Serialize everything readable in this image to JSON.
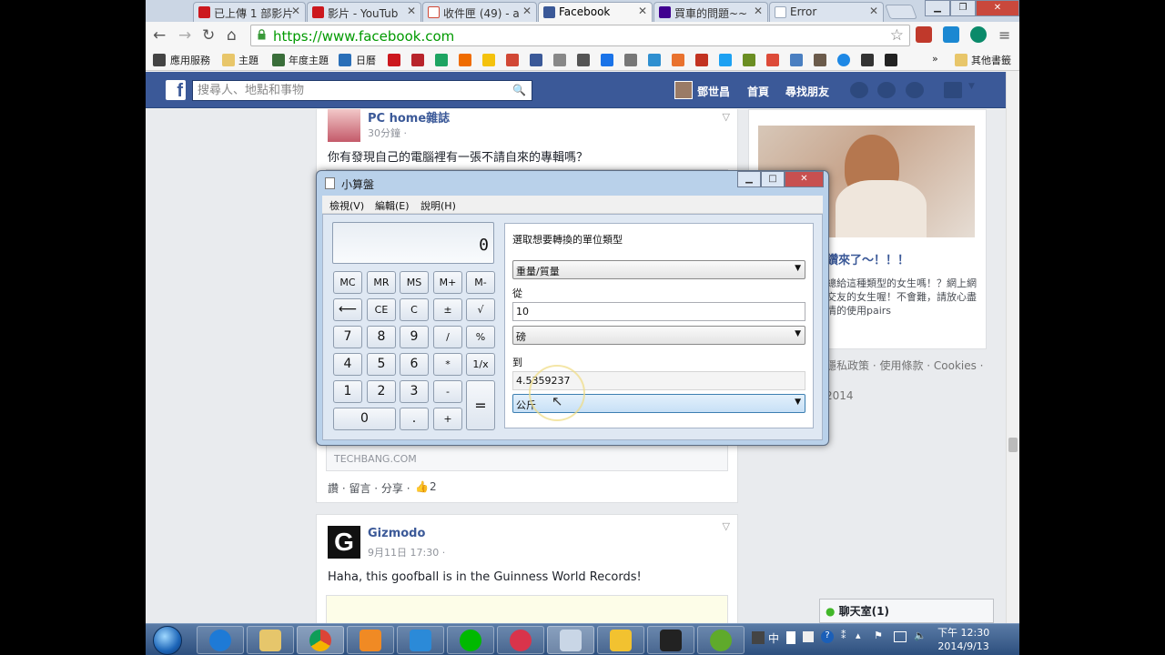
{
  "browser": {
    "tabs": [
      {
        "label": "已上傳 1 部影片",
        "color": "#cc181e"
      },
      {
        "label": "影片 - YouTub",
        "color": "#cc181e"
      },
      {
        "label": "收件匣 (49) - a",
        "color": "#d14836"
      },
      {
        "label": "Facebook",
        "color": "#3b5998"
      },
      {
        "label": "買車的問題~~",
        "color": "#400090"
      },
      {
        "label": "Error",
        "color": "#9aa8bb"
      }
    ],
    "url": "https://www.facebook.com",
    "bookmarks": [
      "應用服務",
      "主題",
      "年度主題",
      "日曆"
    ],
    "bookmarks_more": "»",
    "bookmarks_other": "其他書籤"
  },
  "facebook": {
    "logo": "f",
    "search_placeholder": "搜尋人、地點和事物",
    "nav": {
      "user": "鄧世昌",
      "home": "首頁",
      "find_friends": "尋找朋友"
    },
    "story1": {
      "page": "PC home雜誌",
      "time": "30分鐘 · ",
      "text": "你有發現自己的電腦裡有一張不請自來的專輯嗎？",
      "domain": "TECHBANG.COM",
      "actions": "讚 · 留言 · 分享 · ",
      "likes": "2"
    },
    "story2": {
      "page": "Gizmodo",
      "time": "9月11日 17:30 · ",
      "text": "Haha, this goofball is in the Guinness World Records!"
    },
    "ad": {
      "title": "鑽來了～！！！",
      "body": "總給這種類型的女生嗎！？網上網交友的女生喔！不會難，請放心盡情的使用pairs"
    },
    "footer": "隱私政策 · 使用條款 · Cookies ·",
    "footer_year": "2014",
    "chat": "聊天室(1)"
  },
  "calculator": {
    "title": "小算盤",
    "menu": [
      "檢視(V)",
      "編輯(E)",
      "說明(H)"
    ],
    "display": "0",
    "keys": {
      "mem": [
        "MC",
        "MR",
        "MS",
        "M+",
        "M-"
      ],
      "row2": [
        "⟵",
        "CE",
        "C",
        "±",
        "√"
      ],
      "row3": [
        "7",
        "8",
        "9",
        "/",
        "%"
      ],
      "row4": [
        "4",
        "5",
        "6",
        "*",
        "1/x"
      ],
      "row5": [
        "1",
        "2",
        "3",
        "-"
      ],
      "row6": [
        "0",
        ".",
        "+"
      ],
      "equals": "="
    },
    "unit": {
      "prompt": "選取想要轉換的單位類型",
      "type": "重量/質量",
      "from_label": "從",
      "from_value": "10",
      "from_unit": "磅",
      "to_label": "到",
      "to_value": "4.5359237",
      "to_unit": "公斤"
    }
  },
  "taskbar": {
    "ime": "中",
    "time": "下午 12:30",
    "date": "2014/9/13"
  }
}
